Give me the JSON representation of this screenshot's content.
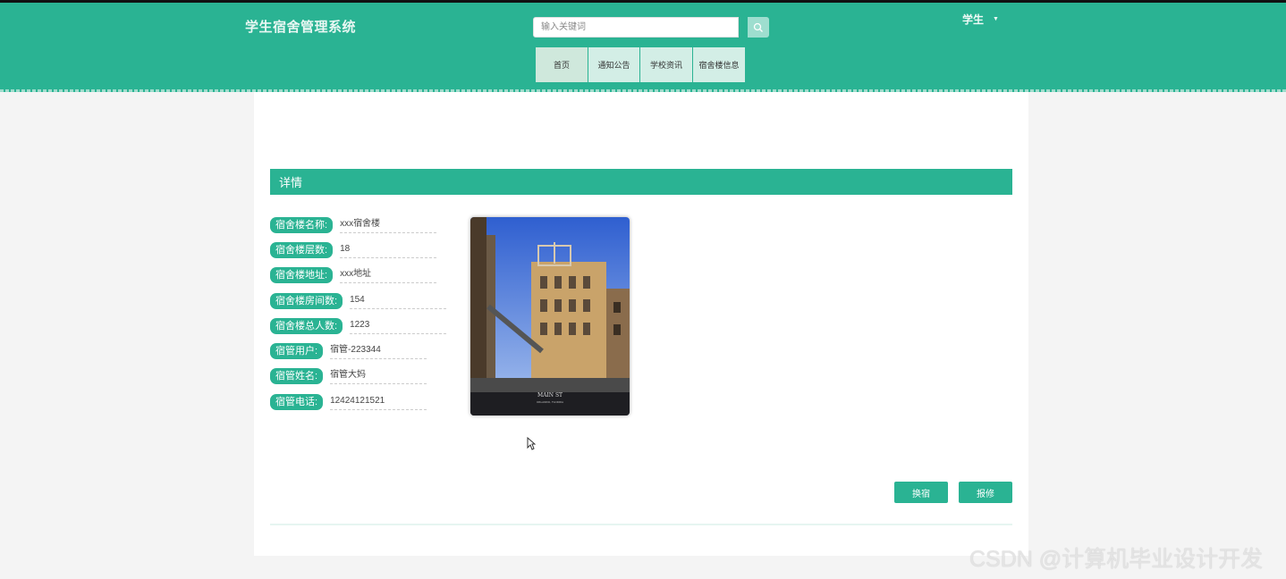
{
  "header": {
    "logo": "学生宿舍管理系统",
    "search_placeholder": "输入关键词",
    "user_label": "学生",
    "nav": [
      "首页",
      "通知公告",
      "学校资讯",
      "宿舍楼信息"
    ]
  },
  "detail": {
    "section_title": "详情",
    "fields": [
      {
        "label": "宿舍楼名称:",
        "value": "xxx宿舍楼"
      },
      {
        "label": "宿舍楼层数:",
        "value": "18"
      },
      {
        "label": "宿舍楼地址:",
        "value": "xxx地址"
      },
      {
        "label": "宿舍楼房间数:",
        "value": "154"
      },
      {
        "label": "宿舍楼总人数:",
        "value": "1223"
      },
      {
        "label": "宿管用户:",
        "value": "宿管-223344"
      },
      {
        "label": "宿管姓名:",
        "value": "宿管大妈"
      },
      {
        "label": "宿管电话:",
        "value": "12424121521"
      }
    ],
    "photo_caption": "MAIN ST",
    "photo_caption_sub": "ORLANDO, FLORIDA",
    "buttons": {
      "checkin": "换宿",
      "repair": "报修"
    }
  },
  "watermark": "CSDN @计算机毕业设计开发",
  "colors": {
    "accent": "#2ab393",
    "nav_bg": "#d3eee6"
  }
}
